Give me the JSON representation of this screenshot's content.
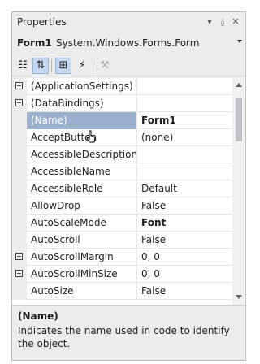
{
  "window": {
    "title": "Properties",
    "pin_glyph": "⍙",
    "close_glyph": "✕",
    "dropdown_glyph": "▾"
  },
  "object_selector": {
    "name": "Form1",
    "type": "System.Windows.Forms.Form"
  },
  "toolbar": {
    "items": [
      {
        "name": "categorized-icon",
        "glyph": "☷",
        "active": false
      },
      {
        "name": "alphabetical-icon",
        "glyph": "⇅",
        "active": true
      },
      {
        "name": "properties-icon",
        "glyph": "⊞",
        "active": true
      },
      {
        "name": "events-icon",
        "glyph": "⚡",
        "active": false
      },
      {
        "name": "property-pages-icon",
        "glyph": "⚒",
        "active": false,
        "disabled": true
      }
    ]
  },
  "properties": [
    {
      "name": "(ApplicationSettings)",
      "value": "",
      "expandable": true
    },
    {
      "name": "(DataBindings)",
      "value": "",
      "expandable": true
    },
    {
      "name": "(Name)",
      "value": "Form1",
      "selected": true,
      "value_bold": true
    },
    {
      "name": "AcceptButton",
      "value": "(none)"
    },
    {
      "name": "AccessibleDescription",
      "value": ""
    },
    {
      "name": "AccessibleName",
      "value": ""
    },
    {
      "name": "AccessibleRole",
      "value": "Default"
    },
    {
      "name": "AllowDrop",
      "value": "False"
    },
    {
      "name": "AutoScaleMode",
      "value": "Font",
      "value_bold": true
    },
    {
      "name": "AutoScroll",
      "value": "False"
    },
    {
      "name": "AutoScrollMargin",
      "value": "0, 0",
      "expandable": true
    },
    {
      "name": "AutoScrollMinSize",
      "value": "0, 0",
      "expandable": true
    },
    {
      "name": "AutoSize",
      "value": "False"
    }
  ],
  "description": {
    "title": "(Name)",
    "text": "Indicates the name used in code to identify the object."
  },
  "colors": {
    "selection": "#9ab0cf",
    "panel_bg": "#ececec"
  }
}
